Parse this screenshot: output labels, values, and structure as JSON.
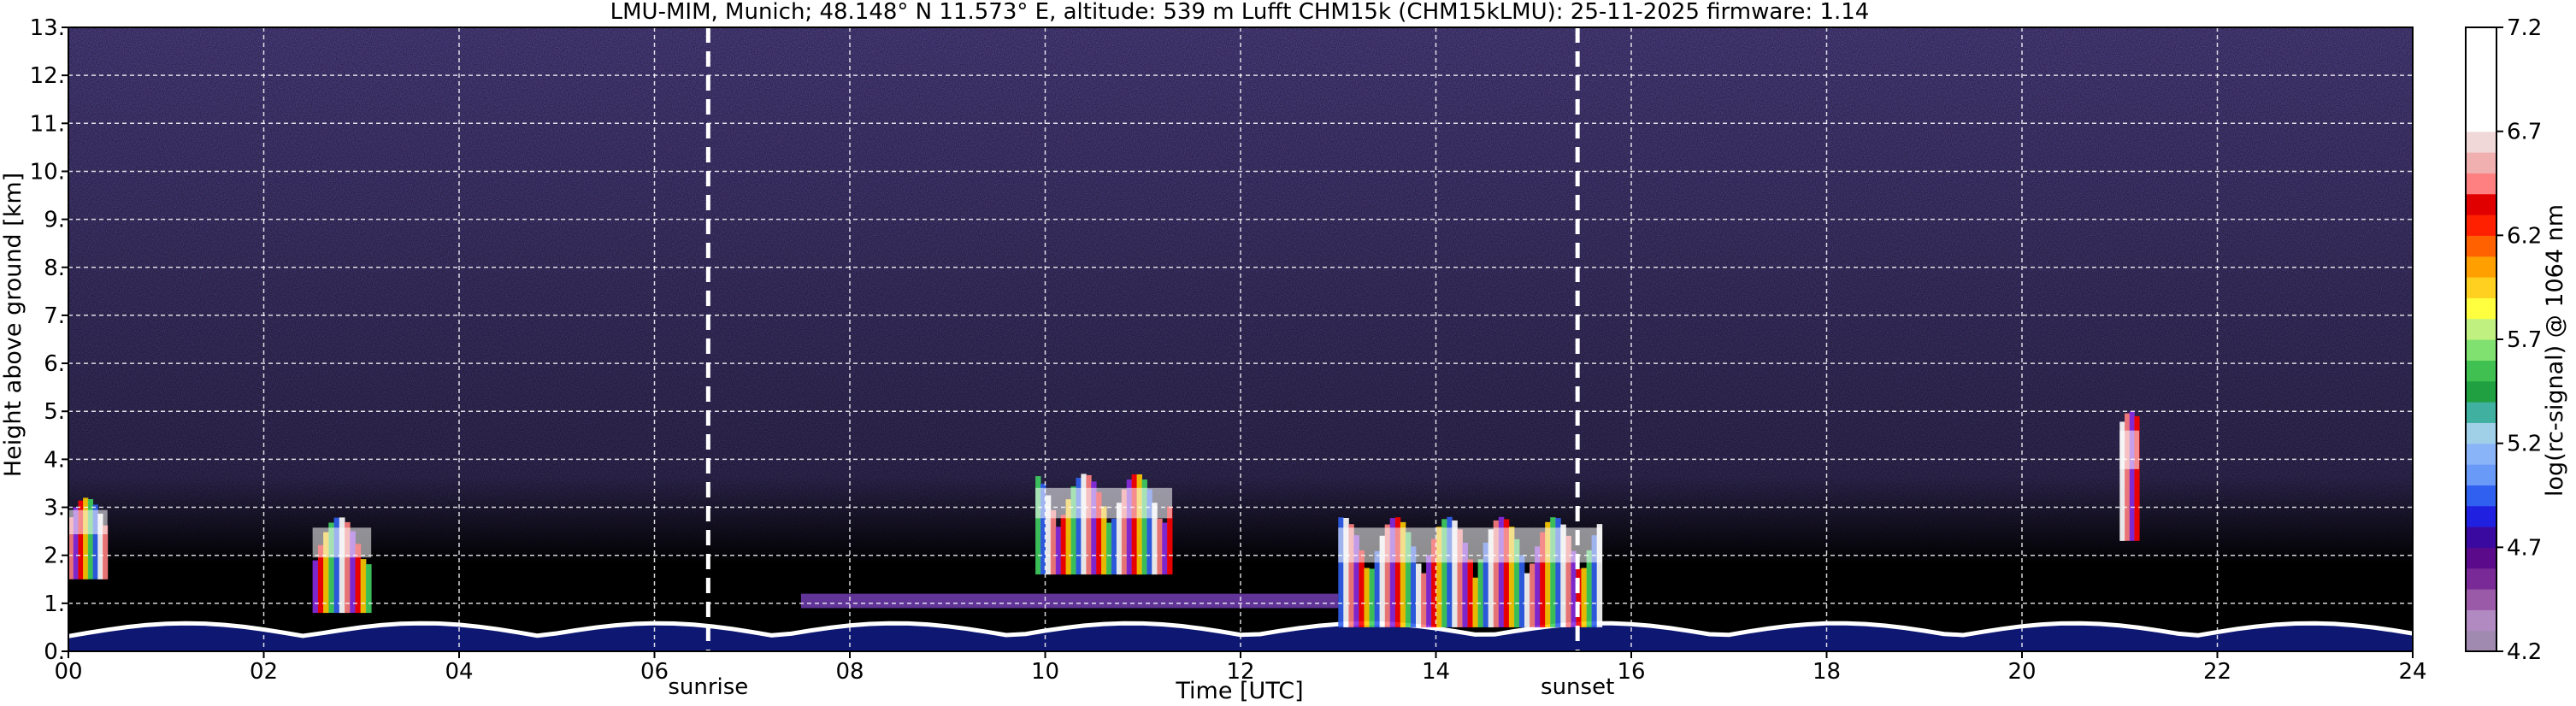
{
  "chart_data": {
    "type": "heatmap",
    "title": "LMU-MIM, Munich; 48.148° N 11.573° E, altitude: 539 m    Lufft CHM15k (CHM15kLMU): 25-11-2025    firmware: 1.14",
    "xlabel": "Time [UTC]",
    "ylabel": "Height above ground [km]",
    "xlim": [
      0,
      24
    ],
    "ylim": [
      0,
      13
    ],
    "x_ticks": [
      "00",
      "02",
      "04",
      "06",
      "08",
      "10",
      "12",
      "14",
      "16",
      "18",
      "20",
      "22",
      "24"
    ],
    "y_ticks": [
      "0.",
      "1.",
      "2.",
      "3.",
      "4.",
      "5.",
      "6.",
      "7.",
      "8.",
      "9.",
      "10.",
      "11.",
      "12.",
      "13."
    ],
    "grid": true,
    "events": [
      {
        "label": "sunrise",
        "time": 6.55
      },
      {
        "label": "sunset",
        "time": 15.45
      }
    ],
    "colorbar": {
      "label": "log(rc-signal) @ 1064 nm",
      "range": [
        4.2,
        7.2
      ],
      "ticks": [
        "4.2",
        "4.7",
        "5.2",
        "5.7",
        "6.2",
        "6.7",
        "7.2"
      ],
      "colors": [
        "#a08ab0",
        "#b08ac0",
        "#9a5aa8",
        "#7a2a96",
        "#5a0a8a",
        "#3a0aa0",
        "#2020e0",
        "#3060f0",
        "#6a9af8",
        "#8ab4f8",
        "#a0d0e8",
        "#40b0a0",
        "#20a040",
        "#40c050",
        "#80e070",
        "#c0f080",
        "#ffff40",
        "#ffd020",
        "#ffa000",
        "#ff6000",
        "#ff2000",
        "#e00000",
        "#ff8080",
        "#f0b0b0",
        "#f0d8d8",
        "#ffffff",
        "#ffffff",
        "#ffffff",
        "#ffffff",
        "#ffffff"
      ]
    },
    "features": [
      {
        "kind": "boundary_layer_top",
        "start": 0,
        "end": 24,
        "height_km": 0.45
      },
      {
        "kind": "aerosol_layer",
        "start": 7.5,
        "end": 13.0,
        "base_km": 0.9,
        "top_km": 1.2
      },
      {
        "kind": "cloud",
        "start": 9.9,
        "end": 11.3,
        "base_km": 1.6,
        "top_km": 3.7
      },
      {
        "kind": "cloud",
        "start": 13.0,
        "end": 15.7,
        "base_km": 0.5,
        "top_km": 2.8
      },
      {
        "kind": "cloud",
        "start": 21.0,
        "end": 21.2,
        "base_km": 2.3,
        "top_km": 5.0
      },
      {
        "kind": "cloud",
        "start": 0.0,
        "end": 0.4,
        "base_km": 1.5,
        "top_km": 3.2
      },
      {
        "kind": "cloud",
        "start": 2.5,
        "end": 3.1,
        "base_km": 0.8,
        "top_km": 2.8
      }
    ]
  }
}
